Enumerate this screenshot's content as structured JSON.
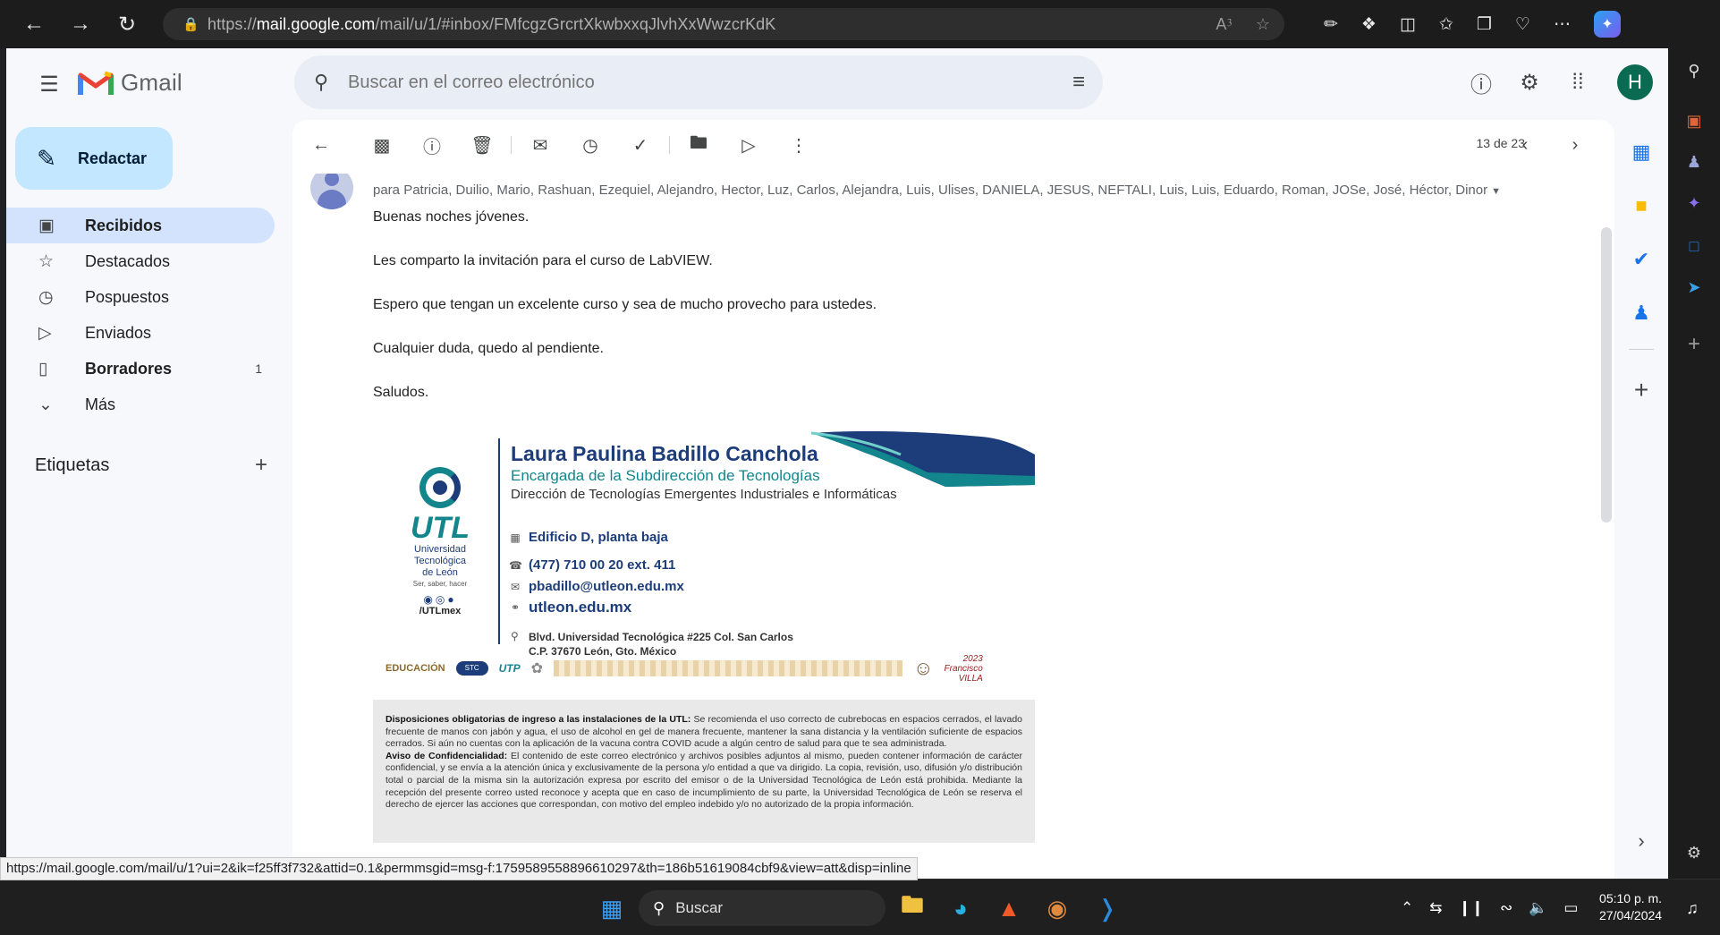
{
  "browser": {
    "url_prefix": "https://",
    "url_host": "mail.google.com",
    "url_path": "/mail/u/1/#inbox/FMfcgzGrcrtXkwbxxqJlvhXxWwzcrKdK"
  },
  "gmail": {
    "logo_text": "Gmail",
    "search_placeholder": "Buscar en el correo electrónico",
    "avatar_initial": "H",
    "compose_label": "Redactar",
    "nav": [
      {
        "label": "Recibidos",
        "icon": "inbox-icon",
        "count": ""
      },
      {
        "label": "Destacados",
        "icon": "star-icon",
        "count": ""
      },
      {
        "label": "Pospuestos",
        "icon": "clock-icon",
        "count": ""
      },
      {
        "label": "Enviados",
        "icon": "send-icon",
        "count": ""
      },
      {
        "label": "Borradores",
        "icon": "draft-icon",
        "count": "1"
      },
      {
        "label": "Más",
        "icon": "chevron-down-icon",
        "count": ""
      }
    ],
    "labels_title": "Etiquetas"
  },
  "message": {
    "pager": "13 de 23",
    "recipients": "para Patricia, Duilio, Mario, Rashuan, Ezequiel, Alejandro, Hector, Luz, Carlos, Alejandra, Luis, Ulises, DANIELA, JESUS, NEFTALI, Luis, Luis, Eduardo, Roman, JOSe, José, Héctor, Dinor",
    "body": [
      "Buenas noches jóvenes.",
      "Les comparto la invitación para el curso de LabVIEW.",
      "Espero que tengan un excelente curso y sea de mucho provecho para ustedes.",
      "Cualquier duda, quedo al pendiente.",
      "Saludos."
    ]
  },
  "signature": {
    "name": "Laura Paulina Badillo Canchola",
    "title": "Encargada de la Subdirección de Tecnologías",
    "department": "Dirección de Tecnologías Emergentes Industriales e Informáticas",
    "building": "Edificio D, planta baja",
    "phone": "(477) 710 00 20 ext. 411",
    "email": "pbadillo@utleon.edu.mx",
    "web": "utleon.edu.mx",
    "address_line1": "Blvd. Universidad Tecnológica #225 Col. San Carlos",
    "address_line2": "C.P. 37670 León, Gto. México",
    "logo_word": "UTL",
    "logo_line1": "Universidad",
    "logo_line2": "Tecnológica",
    "logo_line3": "de León",
    "logo_tagline": "Ser, saber, hacer",
    "social_handle": "/UTLmex",
    "footer_educacion": "EDUCACIÓN",
    "footer_stc": "STC",
    "footer_utp": "UTP",
    "footer_year": "2023",
    "footer_villa_name": "Francisco",
    "footer_villa": "VILLA",
    "disclaimer_head1": "Disposiciones obligatorias de ingreso a las instalaciones de la UTL:",
    "disclaimer_text1": " Se recomienda el uso correcto de cubrebocas en espacios cerrados, el lavado frecuente de manos con jabón y agua, el uso de alcohol en gel de manera frecuente, mantener la sana distancia y la ventilación suficiente de espacios cerrados. Si aún no cuentas con la aplicación de la vacuna contra COVID acude a algún centro de salud para que te sea administrada.",
    "disclaimer_head2": "Aviso de Confidencialidad:",
    "disclaimer_text2": " El contenido de este correo electrónico y archivos posibles adjuntos al mismo, pueden contener información de carácter confidencial, y se envía a la atención única y exclusivamente de la persona y/o entidad a que va dirigido. La copia, revisión, uso, difusión y/o distribución total o parcial de la misma sin la autorización expresa por escrito del emisor o de la Universidad Tecnológica de León está prohibida. Mediante la recepción del presente correo usted reconoce y acepta que en caso de incumplimiento de su parte, la Universidad Tecnológica de León se reserva el derecho de ejercer las acciones que correspondan, con motivo del empleo indebido y/o no autorizado de la propia información."
  },
  "status_url": "https://mail.google.com/mail/u/1?ui=2&ik=f25ff3f732&attid=0.1&permmsgid=msg-f:1759589558896610297&th=186b51619084cbf9&view=att&disp=inline",
  "taskbar": {
    "search_label": "Buscar",
    "time": "05:10 p. m.",
    "date": "27/04/2024"
  },
  "colors": {
    "accent": "#c2e7ff",
    "nav_active": "#d3e3fd",
    "utl_teal": "#12868c",
    "utl_navy": "#1c3d7a"
  }
}
